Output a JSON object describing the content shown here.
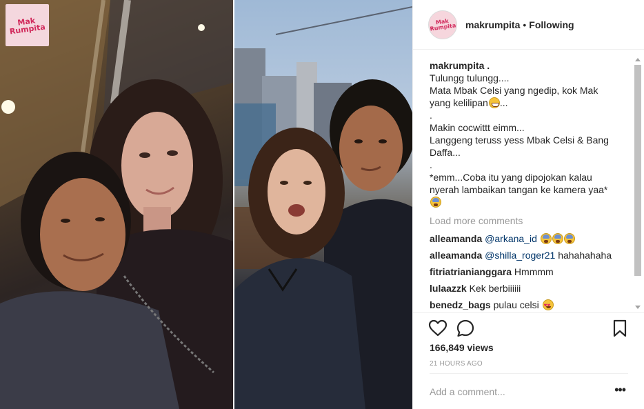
{
  "media": {
    "watermark_text": "Mak\nRumpita",
    "left_photo_icon": "selfie-photo",
    "right_photo_icon": "couple-photo"
  },
  "header": {
    "username": "makrumpita",
    "separator": "•",
    "follow_state": "Following",
    "avatar_text": "Mak\nRumpita"
  },
  "caption": {
    "username": "makrumpita .",
    "lines": [
      "Tulungg tulungg....",
      "Mata Mbak Celsi yang ngedip, kok Mak",
      "yang kelilipan",
      ".",
      "Makin cocwittt eimm...",
      "Langgeng teruss yess Mbak Celsi & Bang",
      "Daffa...",
      ".",
      "*emm...Coba itu yang dipojokan kalau",
      "nyerah lambaikan tangan ke kamera yaa*"
    ],
    "line3_suffix": "...",
    "emoji_icons": [
      "grin-emoji",
      "fear-emoji"
    ]
  },
  "load_more": "Load more comments",
  "comments": [
    {
      "user": "alleamanda",
      "mention": "@arkana_id",
      "text": "",
      "emoji_count": 3,
      "emoji": "fear"
    },
    {
      "user": "alleamanda",
      "mention": "@shilla_roger21",
      "text": "hahahahaha",
      "emoji_count": 0,
      "emoji": ""
    },
    {
      "user": "fitriatrianianggara",
      "mention": "",
      "text": "Hmmmm",
      "emoji_count": 0,
      "emoji": ""
    },
    {
      "user": "lulaazzk",
      "mention": "",
      "text": "Kek berbiiiiii",
      "emoji_count": 0,
      "emoji": ""
    },
    {
      "user": "benedz_bags",
      "mention": "",
      "text": "pulau celsi",
      "emoji_count": 1,
      "emoji": "hearteyes"
    }
  ],
  "stats": {
    "views": "166,849 views",
    "time": "21 HOURS AGO"
  },
  "comment_box": {
    "placeholder": "Add a comment...",
    "more_label": "•••"
  },
  "colors": {
    "accent_link": "#003569",
    "muted": "#999999",
    "brand_pink": "#d12a5c"
  }
}
